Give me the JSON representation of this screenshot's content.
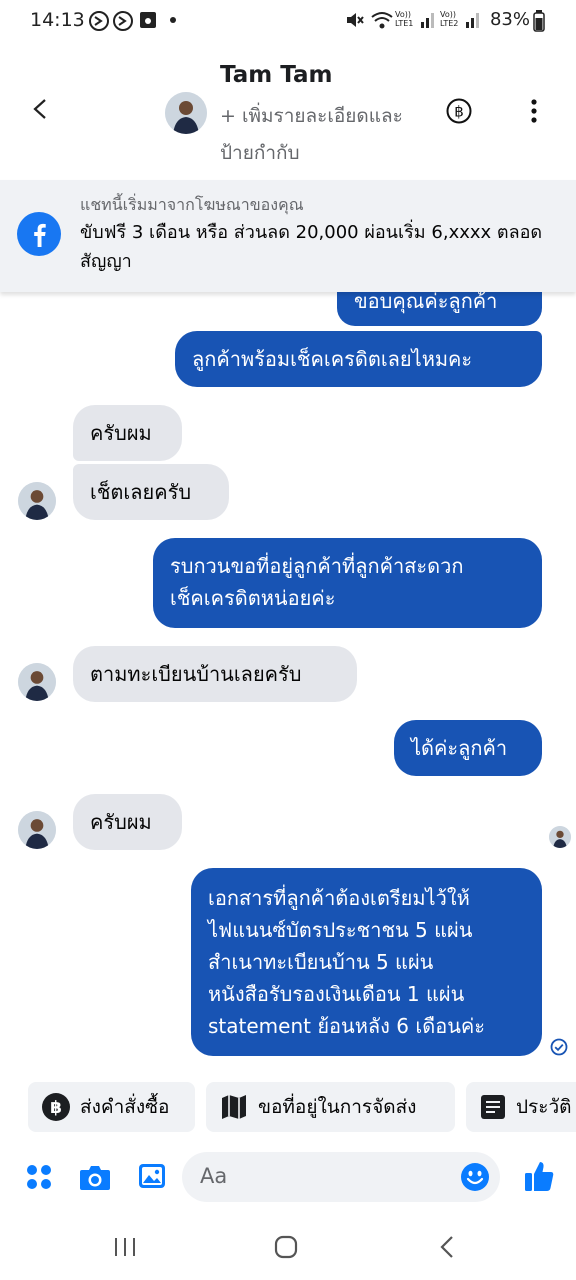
{
  "status_bar": {
    "time": "14:13",
    "battery": "83%",
    "net1": "Vo)) LTE1",
    "net2": "Vo)) LTE2"
  },
  "header": {
    "contact_name": "Tam Tam",
    "subtitle": "+ เพิ่มรายละเอียดและป้ายกำกับ"
  },
  "ad_banner": {
    "source": "แชทนี้เริ่มมาจากโฆษณาของคุณ",
    "text": "ขับฟรี 3 เดือน หรือ ส่วนลด 20,000 ผ่อนเริ่ม 6,xxxx ตลอดสัญญา"
  },
  "messages": [
    {
      "from": "me",
      "text": "ขอบคุณค่ะลูกค้า"
    },
    {
      "from": "me",
      "text": "ลูกค้าพร้อมเช็คเครดิตเลยไหมคะ"
    },
    {
      "from": "them",
      "text": "ครับผม"
    },
    {
      "from": "them",
      "text": "เช็ตเลยครับ"
    },
    {
      "from": "me",
      "text": "รบกวนขอที่อยู่ลูกค้าที่ลูกค้าสะดวก"
    },
    {
      "from": "me",
      "text": "เช็คเครดิตหน่อยค่ะ"
    },
    {
      "from": "them",
      "text": "ตามทะเบียนบ้านเลยครับ"
    },
    {
      "from": "me",
      "text": "ได้ค่ะลูกค้า"
    },
    {
      "from": "them",
      "text": "ครับผม"
    },
    {
      "from": "me",
      "lines": [
        "เอกสารที่ลูกค้าต้องเตรียมไว้ให้",
        "ไฟแนนซ์บัตรประชาชน 5 แผ่น",
        "สำเนาทะเบียนบ้าน 5 แผ่น",
        "หนังสือรับรองเงินเดือน 1 แผ่น",
        "statement ย้อนหลัง 6 เดือนค่ะ"
      ]
    }
  ],
  "quick_replies": [
    {
      "label": "ส่งคำสั่งซื้อ",
      "icon": "baht-icon"
    },
    {
      "label": "ขอที่อยู่ในการจัดส่ง",
      "icon": "map-icon"
    },
    {
      "label": "ประวัติ",
      "icon": "receipt-icon"
    }
  ],
  "composer": {
    "placeholder": "Aa"
  },
  "colors": {
    "outgoing_bubble": "#1854b4",
    "incoming_bubble": "#e4e6eb",
    "accent": "#0a7cff"
  }
}
